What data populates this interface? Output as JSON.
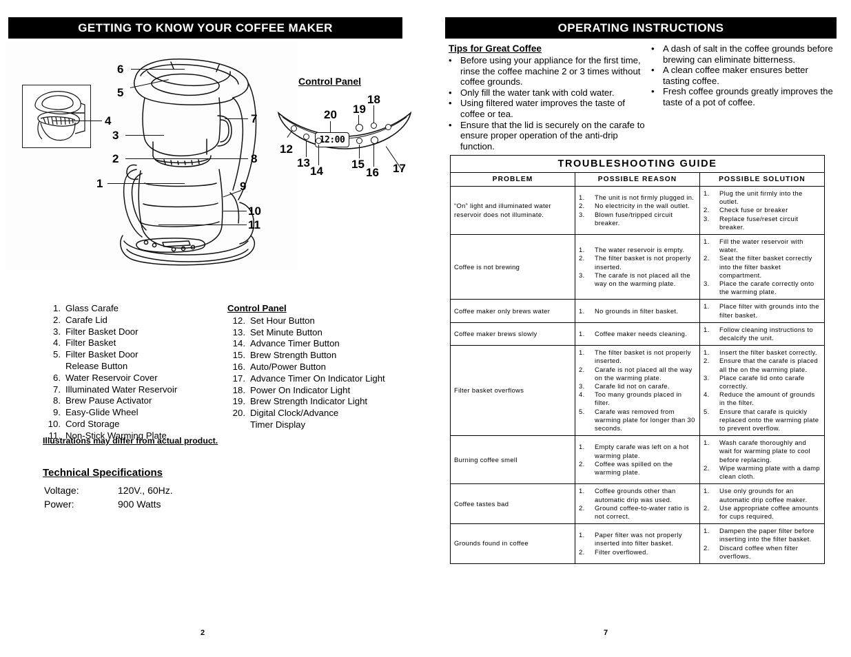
{
  "left_page": {
    "banner": "GETTING TO KNOW  YOUR COFFEE MAKER",
    "page_number": "2",
    "control_panel_figure": {
      "title": "Control Panel",
      "display_value": "12:00",
      "callouts": [
        "12",
        "13",
        "14",
        "15",
        "16",
        "17",
        "18",
        "19",
        "20"
      ]
    },
    "product_callouts": [
      "1",
      "2",
      "3",
      "4",
      "5",
      "6",
      "7",
      "8",
      "9",
      "10",
      "11"
    ],
    "parts_list": [
      {
        "num": "1.",
        "label": "Glass Carafe"
      },
      {
        "num": "2.",
        "label": "Carafe Lid"
      },
      {
        "num": "3.",
        "label": "Filter Basket Door"
      },
      {
        "num": "4.",
        "label": "Filter Basket"
      },
      {
        "num": "5.",
        "label": "Filter Basket Door",
        "cont": "Release Button"
      },
      {
        "num": "6.",
        "label": "Water Reservoir Cover"
      },
      {
        "num": "7.",
        "label": "Illuminated Water Reservoir"
      },
      {
        "num": "8.",
        "label": "Brew Pause Activator"
      },
      {
        "num": "9.",
        "label": "Easy-Glide Wheel"
      },
      {
        "num": "10.",
        "label": "Cord Storage"
      },
      {
        "num": "11.",
        "label": "Non-Stick Warming Plate"
      }
    ],
    "control_panel_list_title": "Control Panel",
    "control_panel_list": [
      {
        "num": "12.",
        "label": "Set Hour Button"
      },
      {
        "num": "13.",
        "label": "Set Minute Button"
      },
      {
        "num": "14.",
        "label": "Advance Timer Button"
      },
      {
        "num": "15.",
        "label": "Brew Strength Button"
      },
      {
        "num": "16.",
        "label": "Auto/Power Button"
      },
      {
        "num": "17.",
        "label": "Advance Timer On Indicator Light"
      },
      {
        "num": "18.",
        "label": "Power On Indicator Light"
      },
      {
        "num": "19.",
        "label": "Brew Strength Indicator Light"
      },
      {
        "num": "20.",
        "label": "Digital Clock/Advance",
        "cont": "Timer Display"
      }
    ],
    "disclaimer": "Illustrations may differ from actual product.",
    "tech_spec_title": "Technical Specifications",
    "tech_specs": [
      {
        "label": "Voltage:",
        "value": "120V.,  60Hz."
      },
      {
        "label": "Power:",
        "value": "900 Watts"
      }
    ]
  },
  "right_page": {
    "banner": "OPERATING INSTRUCTIONS",
    "page_number": "7",
    "tips_title": "Tips for Great Coffee",
    "tips_left": [
      "Before using your appliance for the first time, rinse the coffee machine 2 or 3 times without coffee grounds.",
      "Only fill the water tank with cold water.",
      "Using filtered water improves the taste of coffee or tea.",
      "Ensure that the lid is securely on the carafe to ensure proper operation of the anti-drip function."
    ],
    "tips_right": [
      "A dash of salt in the coffee grounds before brewing can eliminate bitterness.",
      "A clean coffee maker ensures better tasting coffee.",
      "Fresh coffee grounds greatly improves the taste of a pot of coffee."
    ],
    "troubleshooting": {
      "title": "TROUBLESHOOTING GUIDE",
      "headers": [
        "PROBLEM",
        "POSSIBLE REASON",
        "POSSIBLE SOLUTION"
      ],
      "rows": [
        {
          "problem": "“On” light and illuminated water reservoir does not illuminate.",
          "reasons": [
            "The unit is not firmly plugged in.",
            "No electricity in the wall outlet.",
            "Blown fuse/tripped circuit breaker."
          ],
          "solutions": [
            "Plug the unit firmly into the outlet.",
            "Check fuse or breaker",
            "Replace fuse/reset circuit breaker."
          ]
        },
        {
          "problem": "Coffee is not brewing",
          "reasons": [
            "The water reservoir is empty.",
            "The filter basket is not properly inserted.",
            "The carafe is not placed all the way on the warming plate."
          ],
          "solutions": [
            "Fill the water reservoir with water.",
            "Seat the filter basket correctly into the filter basket compartment.",
            "Place the carafe correctly onto the warming plate."
          ]
        },
        {
          "problem": "Coffee maker only brews water",
          "reasons": [
            "No grounds in filter basket."
          ],
          "solutions": [
            "Place filter with grounds into the filter basket."
          ]
        },
        {
          "problem": "Coffee maker brews slowly",
          "reasons": [
            "Coffee maker needs cleaning."
          ],
          "solutions": [
            "Follow cleaning instructions to decalcify the unit."
          ]
        },
        {
          "problem": "Filter basket overflows",
          "reasons": [
            "The filter basket is not properly inserted.",
            "Carafe is not placed all the way on the warming plate.",
            "Carafe lid not on carafe.",
            "Too many grounds placed in filter.",
            "Carafe was removed from warming plate for longer than 30 seconds."
          ],
          "solutions": [
            "Insert the filter basket correctly.",
            "Ensure that the carafe is placed all the on the warming plate.",
            "Place carafe lid onto carafe correctly.",
            "Reduce the amount of grounds in the filter.",
            "Ensure that carafe is quickly replaced onto the warming plate to prevent overflow."
          ]
        },
        {
          "problem": "Burning coffee smell",
          "reasons": [
            "Empty carafe was left on a hot warming plate.",
            "Coffee was spilled on the warming plate."
          ],
          "solutions": [
            "Wash carafe thoroughly and wait for warming plate to cool before replacing.",
            "Wipe warming plate with a damp clean cloth."
          ]
        },
        {
          "problem": "Coffee tastes bad",
          "reasons": [
            "Coffee grounds other than automatic drip was used.",
            "Ground coffee-to-water ratio is not correct."
          ],
          "solutions": [
            "Use only grounds for an automatic drip coffee maker.",
            "Use appropriate coffee amounts for cups required."
          ]
        },
        {
          "problem": "Grounds found in coffee",
          "reasons": [
            "Paper filter was not properly inserted into filter basket.",
            "Filter overflowed."
          ],
          "solutions": [
            "Dampen the paper filter before inserting into the filter basket.",
            "Discard coffee when filter overflows."
          ]
        }
      ]
    }
  }
}
